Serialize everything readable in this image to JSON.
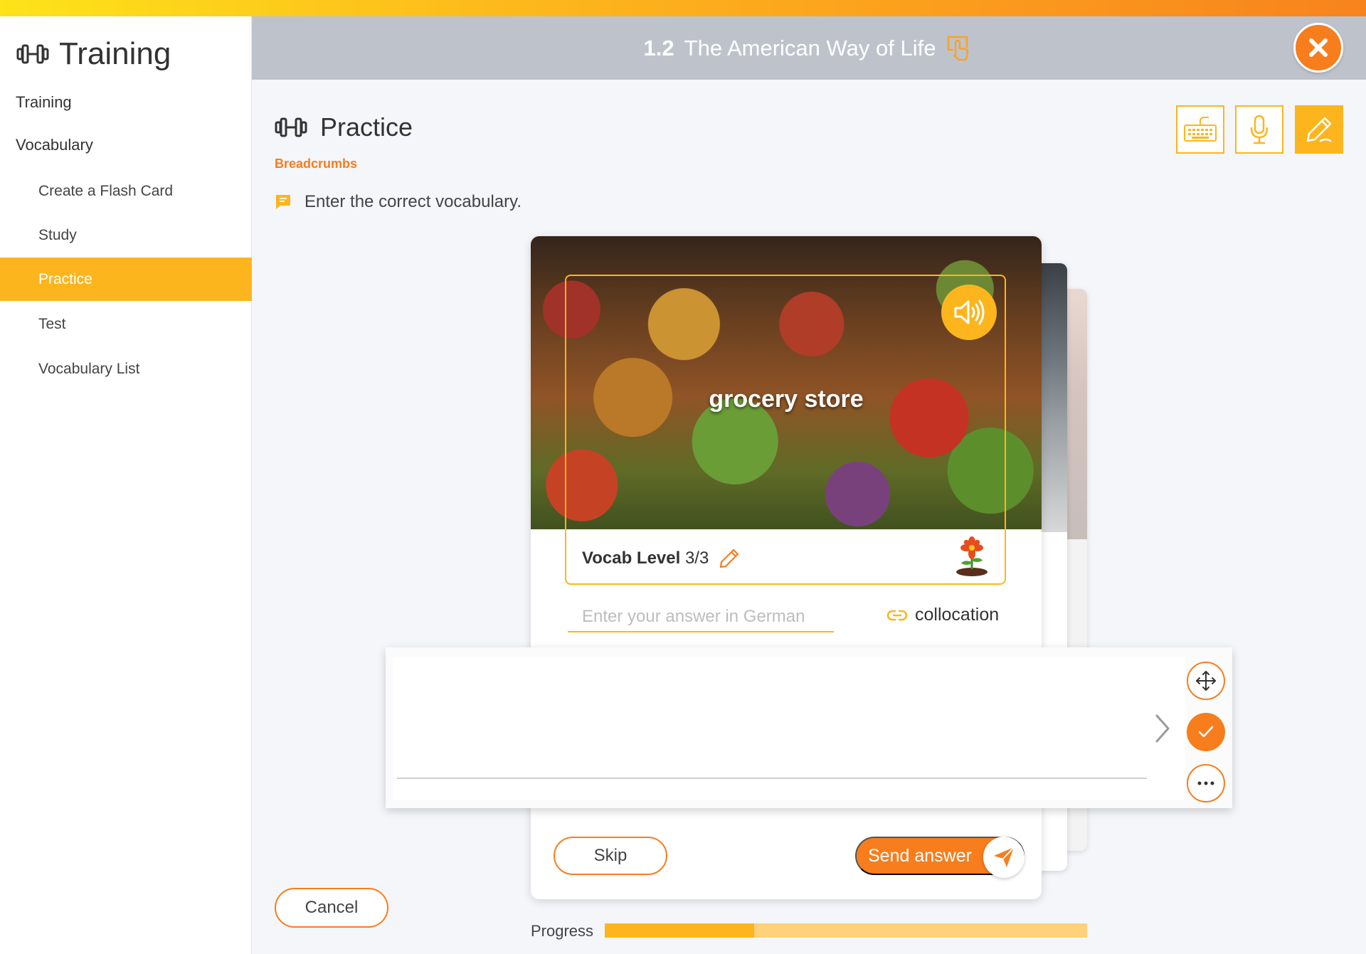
{
  "sidebar": {
    "title": "Training",
    "sections": [
      "Training",
      "Vocabulary"
    ],
    "items": [
      {
        "label": "Create a Flash Card"
      },
      {
        "label": "Study"
      },
      {
        "label": "Practice"
      },
      {
        "label": "Test"
      },
      {
        "label": "Vocabulary List"
      }
    ],
    "active_item": "Practice"
  },
  "header": {
    "lesson_number": "1.2",
    "lesson_title": "The American Way of Life"
  },
  "practice": {
    "title": "Practice",
    "breadcrumbs": "Breadcrumbs",
    "instruction": "Enter the correct vocabulary."
  },
  "modes": [
    "keyboard-icon",
    "microphone-icon",
    "pencil-icon"
  ],
  "card": {
    "word": "grocery store",
    "vocab_level_label": "Vocab Level",
    "vocab_level_value": "3/3",
    "answer_placeholder": "Enter your answer in German",
    "collocation_label": "collocation",
    "skip_label": "Skip",
    "send_label": "Send answer"
  },
  "cancel_label": "Cancel",
  "progress": {
    "label": "Progress",
    "value_percent": 31
  },
  "colors": {
    "accent": "#fdb51e",
    "primary": "#f77d1d",
    "header_bg": "#bec3cb",
    "progress_track": "#fdd27a"
  }
}
